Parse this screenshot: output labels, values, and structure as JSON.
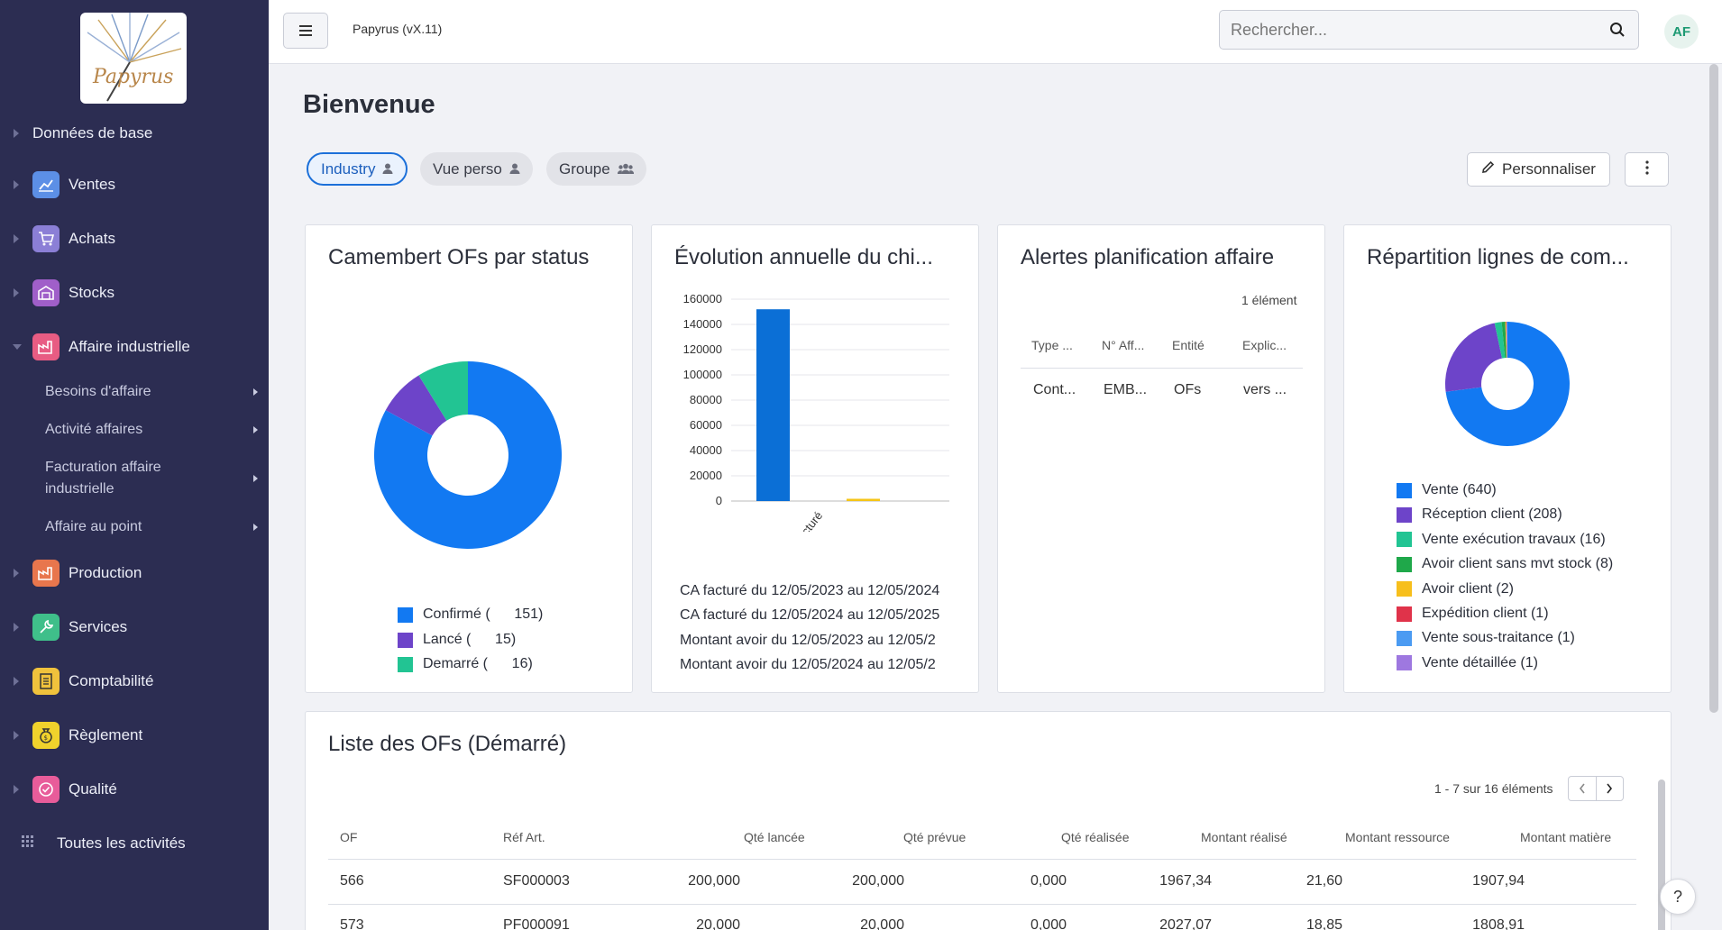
{
  "app": {
    "title": "Papyrus (vX.11)",
    "logo_text": "Papyrus",
    "avatar": "AF"
  },
  "search": {
    "placeholder": "Rechercher..."
  },
  "sidebar": {
    "items": [
      {
        "label": "Données de base",
        "icon": "none"
      },
      {
        "label": "Ventes",
        "icon": "chart-line-icon",
        "color": "#5c8fe6"
      },
      {
        "label": "Achats",
        "icon": "cart-icon",
        "color": "#8b7fd6"
      },
      {
        "label": "Stocks",
        "icon": "warehouse-icon",
        "color": "#a05fc9"
      },
      {
        "label": "Affaire industrielle",
        "icon": "factory-icon",
        "color": "#e85c83"
      },
      {
        "label": "Production",
        "icon": "factory-icon",
        "color": "#e8764d"
      },
      {
        "label": "Services",
        "icon": "wrench-icon",
        "color": "#3fbf8a"
      },
      {
        "label": "Comptabilité",
        "icon": "ledger-icon",
        "color": "#f0c23c"
      },
      {
        "label": "Règlement",
        "icon": "money-bag-icon",
        "color": "#f0d22c"
      },
      {
        "label": "Qualité",
        "icon": "check-badge-icon",
        "color": "#e85c9a"
      },
      {
        "label": "Toutes les activités",
        "icon": "grid-icon"
      }
    ],
    "subitems": [
      {
        "label": "Besoins d'affaire"
      },
      {
        "label": "Activité affaires"
      },
      {
        "label": "Facturation affaire industrielle"
      },
      {
        "label": "Affaire au point"
      }
    ]
  },
  "page": {
    "title": "Bienvenue",
    "tabs": [
      {
        "label": "Industry",
        "active": true
      },
      {
        "label": "Vue perso",
        "active": false
      },
      {
        "label": "Groupe",
        "active": false
      }
    ],
    "customize_label": "Personnaliser"
  },
  "card1": {
    "title": "Camembert OFs par status",
    "legend": [
      {
        "label": "Confirmé (      151)",
        "color": "#1279f2"
      },
      {
        "label": "Lancé (      15)",
        "color": "#6d44c9"
      },
      {
        "label": "Demarré (      16)",
        "color": "#22c493"
      }
    ]
  },
  "card2": {
    "title": "Évolution annuelle du chi...",
    "rows": [
      "CA facturé du 12/05/2023 au 12/05/2024",
      "CA facturé du 12/05/2024 au 12/05/2025",
      "Montant avoir du 12/05/2023 au 12/05/2",
      "Montant avoir du 12/05/2024 au 12/05/2"
    ]
  },
  "card3": {
    "title": "Alertes planification affaire",
    "count": "1 élément",
    "headers": [
      "Type ...",
      "N° Aff...",
      "Entité",
      "Explic..."
    ],
    "row": [
      "Cont...",
      "EMB...",
      "OFs",
      "vers ..."
    ]
  },
  "card4": {
    "title": "Répartition lignes de com...",
    "legend": [
      {
        "label": "Vente (640)",
        "color": "#1279f2"
      },
      {
        "label": "Réception client (208)",
        "color": "#6d44c9"
      },
      {
        "label": "Vente exécution travaux (16)",
        "color": "#22c493"
      },
      {
        "label": "Avoir client sans mvt stock (8)",
        "color": "#1fa84a"
      },
      {
        "label": "Avoir client (2)",
        "color": "#f7bf1c"
      },
      {
        "label": "Expédition client (1)",
        "color": "#e0334a"
      },
      {
        "label": "Vente sous-traitance (1)",
        "color": "#4b9bf2"
      },
      {
        "label": "Vente détaillée (1)",
        "color": "#9e78e0"
      }
    ]
  },
  "list": {
    "title": "Liste des OFs (Démarré)",
    "pagination": "1 - 7 sur 16 éléments",
    "headers": [
      "OF",
      "Réf Art.",
      "Qté lancée",
      "Qté prévue",
      "Qté réalisée",
      "Montant réalisé",
      "Montant ressource",
      "Montant matière"
    ],
    "rows": [
      [
        "566",
        "SF000003",
        "200,000",
        "200,000",
        "0,000",
        "1967,34",
        "21,60",
        "1907,94"
      ],
      [
        "573",
        "PF000091",
        "20,000",
        "20,000",
        "0,000",
        "2027,07",
        "18,85",
        "1808,91"
      ]
    ]
  },
  "chart_data": [
    {
      "type": "pie",
      "title": "Camembert OFs par status",
      "categories": [
        "Confirmé",
        "Lancé",
        "Demarré"
      ],
      "values": [
        151,
        15,
        16
      ]
    },
    {
      "type": "bar",
      "title": "Évolution annuelle du chi...",
      "categories": [
        "CA facturé"
      ],
      "series": [
        {
          "name": "CA facturé du 12/05/2023 au 12/05/2024",
          "values": [
            152000
          ]
        },
        {
          "name": "CA facturé du 12/05/2024 au 12/05/2025",
          "values": [
            1800
          ]
        }
      ],
      "yticks": [
        "0",
        "20000",
        "40000",
        "60000",
        "80000",
        "100000",
        "120000",
        "140000",
        "160000"
      ],
      "ylim": [
        0,
        160000
      ],
      "grid": true
    },
    {
      "type": "pie",
      "title": "Répartition lignes de com...",
      "categories": [
        "Vente",
        "Réception client",
        "Vente exécution travaux",
        "Avoir client sans mvt stock",
        "Avoir client",
        "Expédition client",
        "Vente sous-traitance",
        "Vente détaillée"
      ],
      "values": [
        640,
        208,
        16,
        8,
        2,
        1,
        1,
        1
      ]
    }
  ]
}
